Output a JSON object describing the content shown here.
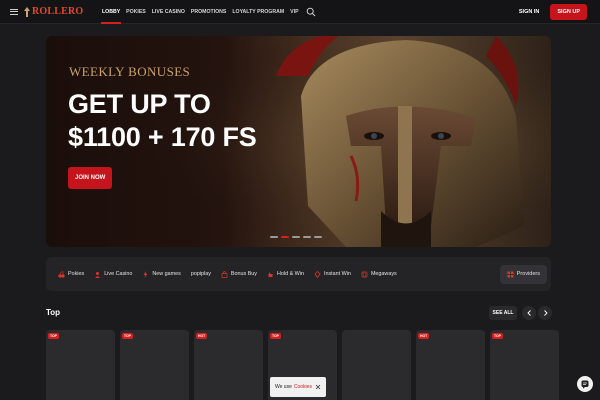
{
  "header": {
    "logo_text": "ROLLERO",
    "nav": [
      "LOBBY",
      "POKIES",
      "LIVE CASINO",
      "PROMOTIONS",
      "LOYALTY PROGRAM",
      "VIP"
    ],
    "active_nav": "LOBBY",
    "signin_label": "SIGN IN",
    "signup_label": "SIGN UP"
  },
  "hero": {
    "eyebrow": "Weekly Bonuses",
    "headline_line1": "GET UP TO",
    "headline_line2": "$1100 + 170 FS",
    "cta_label": "JOIN NOW",
    "slide_count": 5,
    "active_slide": 2
  },
  "categories": [
    {
      "label": "Pokies",
      "icon": "cherry-icon"
    },
    {
      "label": "Live Casino",
      "icon": "live-casino-icon"
    },
    {
      "label": "New games",
      "icon": "lightning-icon"
    },
    {
      "label": "popiplay",
      "icon": ""
    },
    {
      "label": "Bonus Buy",
      "icon": "bonus-buy-icon"
    },
    {
      "label": "Hold & Win",
      "icon": "hold-win-icon"
    },
    {
      "label": "Instant Win",
      "icon": "instant-win-icon"
    },
    {
      "label": "Megaways",
      "icon": "megaways-icon"
    }
  ],
  "providers_label": "Providers",
  "top_section": {
    "title": "Top",
    "see_all_label": "SEE ALL",
    "cards": [
      {
        "badge": "TOP"
      },
      {
        "badge": "TOP"
      },
      {
        "badge": "HOT"
      },
      {
        "badge": "TOP"
      },
      {
        "badge": ""
      },
      {
        "badge": "HOT"
      },
      {
        "badge": "TOP"
      }
    ]
  },
  "cookie_toast": {
    "text": "We use",
    "link": "Cookies"
  },
  "colors": {
    "accent": "#d71f1f",
    "background": "#1b1b1d",
    "gold": "#c9a36b"
  }
}
